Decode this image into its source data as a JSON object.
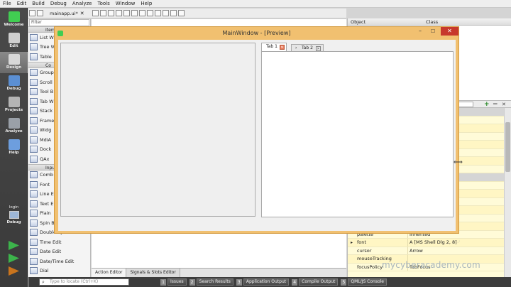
{
  "menubar": {
    "items": [
      "File",
      "Edit",
      "Build",
      "Debug",
      "Analyze",
      "Tools",
      "Window",
      "Help"
    ]
  },
  "modes": [
    {
      "label": "Welcome",
      "icon": "qt-logo-icon"
    },
    {
      "label": "Edit",
      "icon": "edit-icon"
    },
    {
      "label": "Design",
      "icon": "design-icon"
    },
    {
      "label": "Debug",
      "icon": "debug-icon"
    },
    {
      "label": "Projects",
      "icon": "projects-icon"
    },
    {
      "label": "Analyze",
      "icon": "analyze-icon"
    },
    {
      "label": "Help",
      "icon": "help-icon"
    }
  ],
  "kit": {
    "project": "login",
    "config": "Debug"
  },
  "document": {
    "name": "mainapp.ui*"
  },
  "widgetbox": {
    "filter_placeholder": "Filter",
    "items": [
      {
        "label": "Item W",
        "type": "cat"
      },
      {
        "label": "List W",
        "type": "item"
      },
      {
        "label": "Tree W",
        "type": "item"
      },
      {
        "label": "Table",
        "type": "item"
      },
      {
        "label": "Co",
        "type": "cat"
      },
      {
        "label": "Group",
        "type": "item"
      },
      {
        "label": "Scroll",
        "type": "item"
      },
      {
        "label": "Tool B",
        "type": "item"
      },
      {
        "label": "Tab W",
        "type": "item"
      },
      {
        "label": "Stack",
        "type": "item"
      },
      {
        "label": "Frame",
        "type": "item"
      },
      {
        "label": "Widg",
        "type": "item"
      },
      {
        "label": "MdiA",
        "type": "item"
      },
      {
        "label": "Dock",
        "type": "item"
      },
      {
        "label": "QAx",
        "type": "item"
      },
      {
        "label": "Inpu",
        "type": "cat"
      },
      {
        "label": "Comb",
        "type": "item"
      },
      {
        "label": "Font",
        "type": "item"
      },
      {
        "label": "Line E",
        "type": "item"
      },
      {
        "label": "Text E",
        "type": "item"
      },
      {
        "label": "Plain",
        "type": "item"
      },
      {
        "label": "Spin B",
        "type": "item"
      },
      {
        "label": "Double Spin Box",
        "type": "item"
      },
      {
        "label": "Time Edit",
        "type": "item"
      },
      {
        "label": "Date Edit",
        "type": "item"
      },
      {
        "label": "Date/Time Edit",
        "type": "item"
      },
      {
        "label": "Dial",
        "type": "item"
      }
    ]
  },
  "editor_tabs": [
    "Action Editor",
    "Signals & Slots Editor"
  ],
  "object_inspector": {
    "col_object": "Object",
    "col_class": "Class"
  },
  "property_editor": {
    "rows": [
      {
        "name": "",
        "value": "",
        "kind": "hdr"
      },
      {
        "name": "",
        "value": "",
        "kind": "plain"
      },
      {
        "name": "",
        "value": "",
        "kind": "alt"
      },
      {
        "name": "",
        "value": "",
        "kind": "plain"
      },
      {
        "name": "",
        "value": "",
        "kind": "alt"
      },
      {
        "name": "",
        "value": "",
        "kind": "plain"
      },
      {
        "name": "",
        "value": "], 0]",
        "kind": "alt"
      },
      {
        "name": "",
        "value": "",
        "kind": "plain"
      },
      {
        "name": "",
        "value": "",
        "kind": "hdr"
      },
      {
        "name": "",
        "value": "",
        "kind": "plain"
      },
      {
        "name": "",
        "value": "",
        "kind": "alt"
      },
      {
        "name": "",
        "value": "",
        "kind": "plain"
      },
      {
        "name": "",
        "value": "",
        "kind": "alt"
      },
      {
        "name": "",
        "value": "",
        "kind": "plain"
      },
      {
        "name": "baseSize",
        "value": "0 x 0",
        "kind": "alt"
      },
      {
        "name": "palette",
        "value": "Inherited",
        "kind": "plain"
      },
      {
        "name": "font",
        "value": "A  [MS Shell Dlg 2, 8]",
        "kind": "alt"
      },
      {
        "name": "cursor",
        "value": "Arrow",
        "kind": "plain"
      },
      {
        "name": "mouseTracking",
        "value": "",
        "kind": "alt"
      },
      {
        "name": "focusPolicy",
        "value": "TabFocus",
        "kind": "plain"
      }
    ]
  },
  "locator": {
    "placeholder": "Type to locate (Ctrl+K)"
  },
  "output_panes": [
    {
      "n": "1",
      "label": "Issues"
    },
    {
      "n": "2",
      "label": "Search Results"
    },
    {
      "n": "3",
      "label": "Application Output"
    },
    {
      "n": "4",
      "label": "Compile Output"
    },
    {
      "n": "5",
      "label": "QML/JS Console"
    }
  ],
  "preview": {
    "title": "MainWindow - [Preview]",
    "tabs": [
      {
        "label": "Tab 1"
      },
      {
        "label": "Tab 2"
      }
    ]
  },
  "watermark": "mycyberacademy.com"
}
